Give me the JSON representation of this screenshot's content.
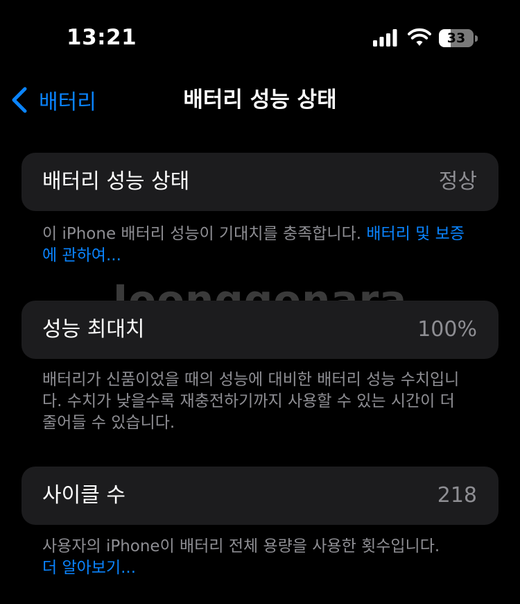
{
  "status_bar": {
    "time": "13:21",
    "battery_level": "33",
    "battery_fraction": 0.33,
    "icons": [
      "cellular-signal-icon",
      "wifi-icon",
      "battery-icon"
    ]
  },
  "nav": {
    "back_label": "배터리",
    "title": "배터리 성능 상태"
  },
  "sections": [
    {
      "label": "배터리 성능 상태",
      "value": "정상",
      "footnote": "이 iPhone 배터리 성능이 기대치를 충족합니다. ",
      "footnote_link": "배터리 및 보증에 관하여..."
    },
    {
      "label": "성능 최대치",
      "value": "100%",
      "footnote": "배터리가 신품이었을 때의 성능에 대비한 배터리 성능 수치입니다. 수치가 낮을수록 재충전하기까지 사용할 수 있는 시간이 더 줄어들 수 있습니다."
    },
    {
      "label": "사이클 수",
      "value": "218",
      "footnote": "사용자의 iPhone이 배터리 전체 용량을 사용한 횟수입니다.",
      "footnote_link": "더 알아보기..."
    }
  ],
  "watermark": "Joonggonara",
  "colors": {
    "background": "#000000",
    "card": "#1c1c1e",
    "accent": "#0a84ff",
    "secondary_text": "#8e8e93"
  }
}
